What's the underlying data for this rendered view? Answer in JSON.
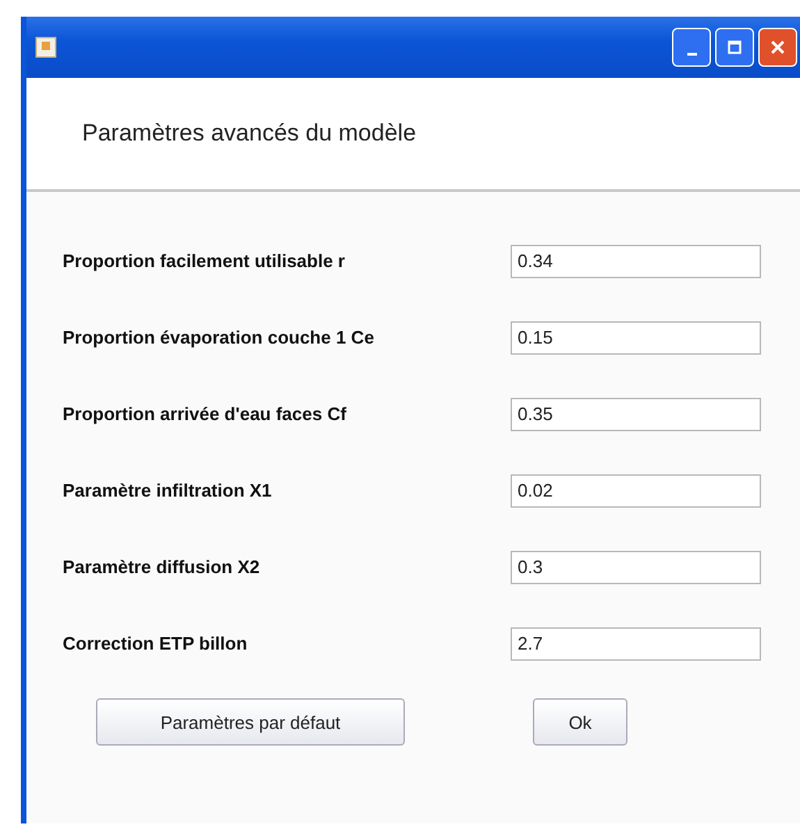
{
  "window": {
    "title": "Paramètres avancés du modèle"
  },
  "fields": [
    {
      "label": "Proportion facilement utilisable r",
      "value": "0.34"
    },
    {
      "label": "Proportion évaporation couche 1 Ce",
      "value": "0.15"
    },
    {
      "label": "Proportion arrivée d'eau faces Cf",
      "value": "0.35"
    },
    {
      "label": "Paramètre infiltration X1",
      "value": "0.02"
    },
    {
      "label": "Paramètre diffusion X2",
      "value": "0.3"
    },
    {
      "label": "Correction ETP billon",
      "value": "2.7"
    }
  ],
  "buttons": [
    "Paramètres par défaut",
    "Ok"
  ]
}
